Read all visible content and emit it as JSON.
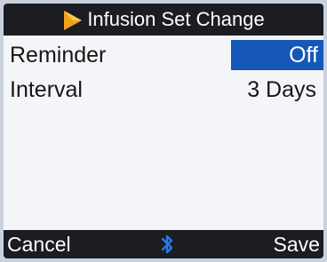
{
  "title": "Infusion Set Change",
  "icons": {
    "title": "play-triangle-icon",
    "status": "bluetooth-icon"
  },
  "settings": {
    "reminder": {
      "label": "Reminder",
      "value": "Off"
    },
    "interval": {
      "label": "Interval",
      "value": "3 Days"
    }
  },
  "softkeys": {
    "left": "Cancel",
    "right": "Save"
  },
  "colors": {
    "bar_background": "#1b1d22",
    "highlight": "#1457b8",
    "title_icon": "#f2a11d",
    "bluetooth": "#2a78e4"
  }
}
